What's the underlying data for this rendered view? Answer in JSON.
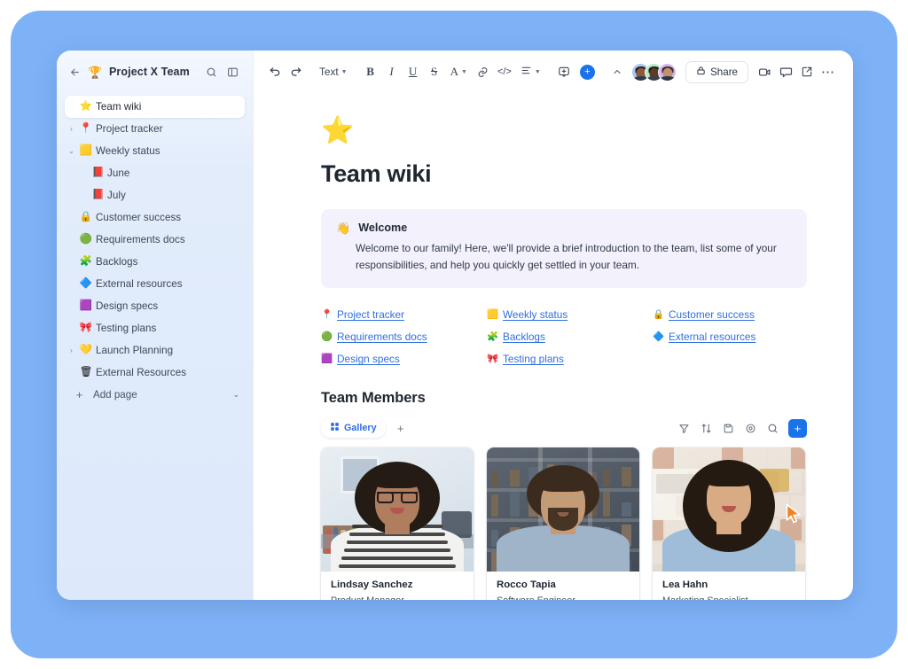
{
  "theme": {
    "backdrop": "#7eb2f7",
    "accent": "#1a73e8",
    "link": "#2f6fe0",
    "callout_bg": "#f3f1fb",
    "sidebar_bg": "#dde9fb"
  },
  "sidebar": {
    "back_icon": "back-arrow-icon",
    "workspace_emoji": "🏆",
    "title": "Project X Team",
    "search_icon": "search-icon",
    "panel_icon": "toggle-panel-icon",
    "items": [
      {
        "label": "Team wiki",
        "emoji": "⭐",
        "caret": "",
        "active": true,
        "child": false
      },
      {
        "label": "Project tracker",
        "emoji": "📍",
        "caret": "›",
        "active": false,
        "child": false
      },
      {
        "label": "Weekly status",
        "emoji": "🟨",
        "caret": "⌄",
        "active": false,
        "child": false
      },
      {
        "label": "June",
        "emoji": "📕",
        "caret": "",
        "active": false,
        "child": true
      },
      {
        "label": "July",
        "emoji": "📕",
        "caret": "",
        "active": false,
        "child": true
      },
      {
        "label": "Customer success",
        "emoji": "🔒",
        "caret": "",
        "active": false,
        "child": false
      },
      {
        "label": "Requirements docs",
        "emoji": "🟢",
        "caret": "",
        "active": false,
        "child": false
      },
      {
        "label": "Backlogs",
        "emoji": "🧩",
        "caret": "",
        "active": false,
        "child": false
      },
      {
        "label": "External resources",
        "emoji": "🔷",
        "caret": "",
        "active": false,
        "child": false
      },
      {
        "label": "Design specs",
        "emoji": "🟪",
        "caret": "",
        "active": false,
        "child": false
      },
      {
        "label": "Testing plans",
        "emoji": "🎀",
        "caret": "",
        "active": false,
        "child": false
      },
      {
        "label": "Launch Planning",
        "emoji": "💛",
        "caret": "›",
        "active": false,
        "child": false
      },
      {
        "label": "External Resources",
        "emoji": "🗑",
        "caret": "",
        "active": false,
        "child": false
      }
    ],
    "add_page": {
      "label": "Add page",
      "plus": "+",
      "chevron": "⌄"
    }
  },
  "toolbar": {
    "undo": "undo-icon",
    "redo": "redo-icon",
    "text_style_label": "Text",
    "bold": "B",
    "italic": "I",
    "underline": "U",
    "strikethrough": "S",
    "text_color": "A",
    "link": "link-icon",
    "code": "</>",
    "align": "align-icon",
    "comment": "comment-add-icon",
    "insert": "+",
    "collapse": "^",
    "share_label": "Share",
    "share_icon": "lock-icon",
    "video_icon": "video-camera-icon",
    "chat_icon": "chat-bubble-icon",
    "open_icon": "open-external-icon",
    "more_icon": "more-horizontal-icon",
    "avatars": [
      {
        "name": "avatar-1",
        "bg": "#a9c7f5",
        "hair": "#30241a",
        "skin": "#8a5a3b"
      },
      {
        "name": "avatar-2",
        "bg": "#b4ebc4",
        "hair": "#2a2118",
        "skin": "#5d3c27"
      },
      {
        "name": "avatar-3",
        "bg": "#d3b6f5",
        "hair": "#3b2a1c",
        "skin": "#c29070"
      }
    ]
  },
  "page": {
    "emoji": "⭐",
    "title": "Team wiki",
    "callout": {
      "emoji": "👋",
      "title": "Welcome",
      "body": "Welcome to our family! Here, we'll provide a brief introduction to the team, list some of your responsibilities, and help you quickly get settled in your team."
    },
    "links": [
      {
        "label": "Project tracker",
        "emoji": "📍"
      },
      {
        "label": "Weekly status",
        "emoji": "🟨"
      },
      {
        "label": "Customer success",
        "emoji": "🔒"
      },
      {
        "label": "Requirements docs",
        "emoji": "🟢"
      },
      {
        "label": "Backlogs",
        "emoji": "🧩"
      },
      {
        "label": "External resources",
        "emoji": "🔷"
      },
      {
        "label": "Design specs",
        "emoji": "🟪"
      },
      {
        "label": "Testing plans",
        "emoji": "🎀"
      }
    ]
  },
  "team": {
    "section_title": "Team Members",
    "view_label": "Gallery",
    "view_icon": "gallery-grid-icon",
    "add_view": "+",
    "tools": [
      {
        "name": "filter-icon"
      },
      {
        "name": "sort-icon"
      },
      {
        "name": "save-view-icon"
      },
      {
        "name": "settings-icon"
      },
      {
        "name": "search-icon"
      }
    ],
    "add_record": "+",
    "members": [
      {
        "name": "Lindsay Sanchez",
        "role": "Product Manager"
      },
      {
        "name": "Rocco Tapia",
        "role": "Software Engineer"
      },
      {
        "name": "Lea Hahn",
        "role": "Marketing Specialist"
      }
    ]
  },
  "cursor": {
    "name": "mouse-pointer",
    "color": "#f5821f"
  }
}
